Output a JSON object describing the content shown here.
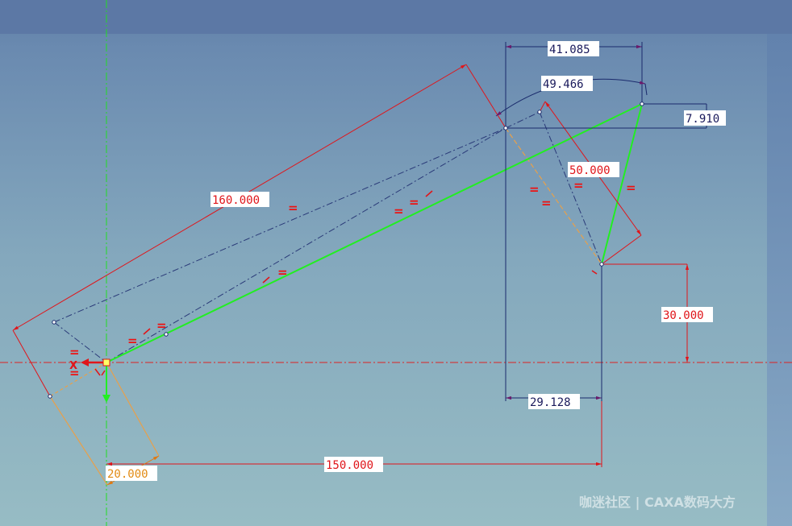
{
  "dimensions": {
    "d_41085": "41.085",
    "d_49466": "49.466",
    "d_7910": "7.910",
    "d_160000": "160.000",
    "d_50000": "50.000",
    "d_30000": "30.000",
    "d_29128": "29.128",
    "d_150000": "150.000",
    "d_20000": "20.000"
  },
  "constraints": {
    "equal_symbol": "="
  },
  "origin": {
    "axis_label": "X"
  },
  "watermark": {
    "text": "咖迷社区 | CAXA数码大方"
  },
  "colors": {
    "background_top": "#5c78a5",
    "background_bottom": "#97bcc4",
    "sketch_green": "#22ee22",
    "dimension_red": "#e0151a",
    "dimension_navy": "#1a1a5c",
    "centerline_green": "#22dd22",
    "centerline_red": "#dd2222",
    "construction_orange": "#e8a04a"
  }
}
